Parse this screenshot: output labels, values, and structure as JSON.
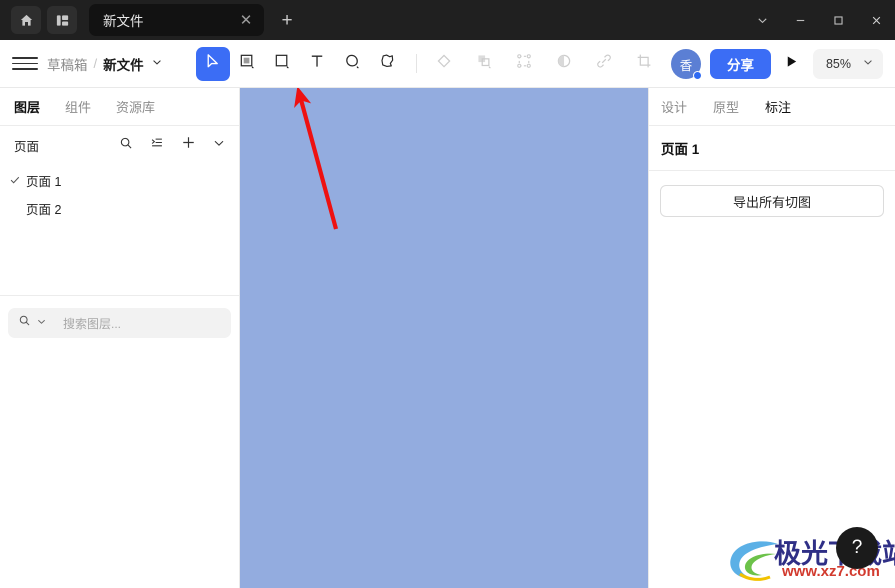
{
  "titlebar": {
    "home_icon": "home-icon",
    "dashboard_icon": "dashboard-icon",
    "tab": {
      "title": "新文件",
      "close_label": "✕"
    },
    "new_tab_label": "+",
    "window_controls": {
      "more_label": "chevron-down-icon",
      "minimize_label": "minimize-icon",
      "maximize_label": "maximize-icon",
      "close_label": "close-icon"
    }
  },
  "toolbar": {
    "menu_icon": "hamburger-icon",
    "breadcrumb": {
      "parent": "草稿箱",
      "separator": "/",
      "current": "新文件"
    },
    "tools": [
      {
        "name": "move-tool",
        "icon": "cursor-icon",
        "active": true
      },
      {
        "name": "frame-tool",
        "icon": "frame-icon",
        "active": false
      },
      {
        "name": "rectangle-tool",
        "icon": "rectangle-icon",
        "active": false
      },
      {
        "name": "text-tool",
        "icon": "text-icon",
        "active": false
      },
      {
        "name": "pen-tool",
        "icon": "ellipse-icon",
        "active": false
      },
      {
        "name": "polygon-tool",
        "icon": "polygon-icon",
        "active": false
      }
    ],
    "secondary_tools": [
      {
        "name": "component-tool",
        "icon": "diamond-icon"
      },
      {
        "name": "boolean-tool",
        "icon": "boolean-icon"
      },
      {
        "name": "group-tool",
        "icon": "group-icon"
      },
      {
        "name": "mask-tool",
        "icon": "mask-icon"
      },
      {
        "name": "link-tool",
        "icon": "link-icon"
      },
      {
        "name": "crop-tool",
        "icon": "crop-icon"
      }
    ],
    "avatar": {
      "initial": "香"
    },
    "share_label": "分享",
    "present_icon": "play-icon",
    "zoom_value": "85%"
  },
  "left_panel": {
    "tabs": [
      {
        "label": "图层",
        "active": true
      },
      {
        "label": "组件",
        "active": false
      },
      {
        "label": "资源库",
        "active": false
      }
    ],
    "pages_section": {
      "title": "页面",
      "icons": [
        "search-icon",
        "sort-icon",
        "add-icon",
        "chevron-down-icon"
      ],
      "items": [
        {
          "label": "页面 1",
          "selected": true
        },
        {
          "label": "页面 2",
          "selected": false
        }
      ]
    },
    "layer_search": {
      "placeholder": "搜索图层...",
      "value": ""
    }
  },
  "right_panel": {
    "tabs": [
      {
        "label": "设计",
        "active": false
      },
      {
        "label": "原型",
        "active": false
      },
      {
        "label": "标注",
        "active": true
      }
    ],
    "title": "页面 1",
    "export_button": "导出所有切图"
  },
  "canvas": {
    "background_color": "#93acdf",
    "annotation": {
      "type": "arrow",
      "color": "#ee1111"
    }
  },
  "overlay": {
    "watermark_text": "极光下载站",
    "watermark_url": "www.xz7.com",
    "help_label": "?"
  },
  "colors": {
    "accent": "#3b6df5",
    "titlebar_bg": "#202020",
    "canvas_bg": "#93acdf",
    "annotation_red": "#ee1111"
  }
}
